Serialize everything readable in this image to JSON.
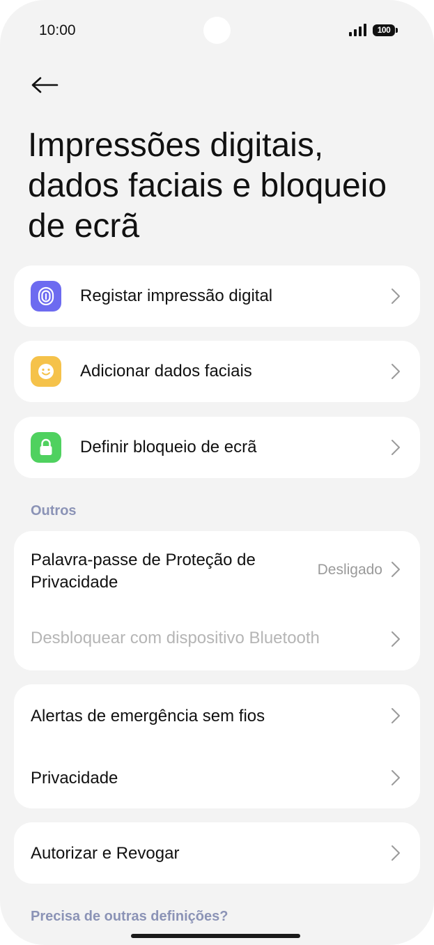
{
  "status": {
    "time": "10:00",
    "battery": "100"
  },
  "title": "Impressões digitais, dados faciais e bloqueio de ecrã",
  "items": {
    "fingerprint": "Registar impressão digital",
    "face": "Adicionar dados faciais",
    "screen_lock": "Definir bloqueio de ecrã"
  },
  "others": {
    "section_title": "Outros",
    "privacy_password": "Palavra-passe de Proteção de Privacidade",
    "privacy_password_value": "Desligado",
    "bluetooth_unlock": "Desbloquear com dispositivo Bluetooth",
    "emergency_alerts": "Alertas de emergência sem fios",
    "privacy": "Privacidade",
    "authorize_revoke": "Autorizar e Revogar"
  },
  "footer": {
    "help_text": "Precisa de outras definições?"
  },
  "colors": {
    "fingerprint_icon": "#6d6bf0",
    "face_icon": "#f5c24a",
    "lock_icon": "#4fd15f",
    "section_label": "#8b93b6"
  },
  "icons": [
    "back-arrow-icon",
    "fingerprint-icon",
    "face-icon",
    "lock-icon",
    "chevron-right-icon",
    "signal-icon",
    "battery-icon"
  ]
}
